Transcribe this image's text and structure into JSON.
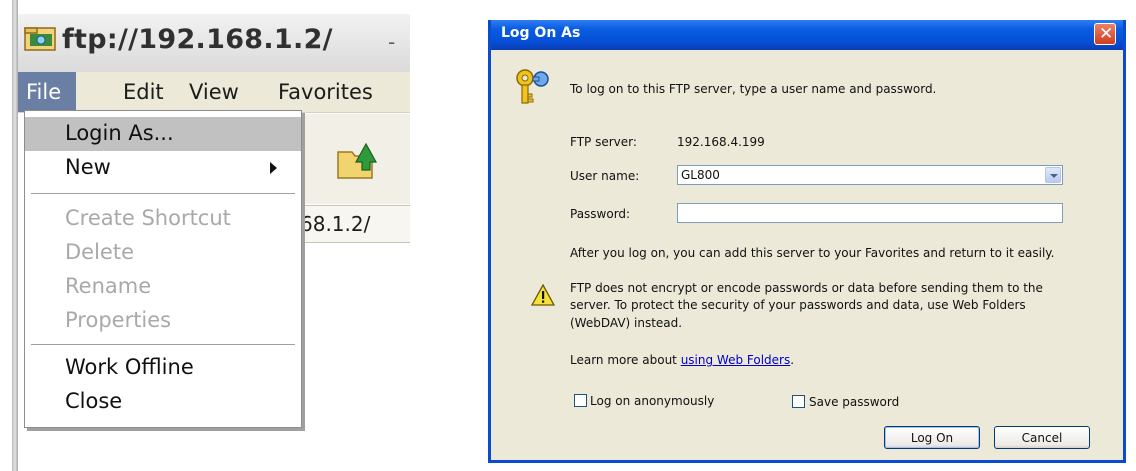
{
  "explorer": {
    "title": "ftp://192.168.1.2/",
    "title_suffix": "-",
    "menubar": [
      "File",
      "Edit",
      "View",
      "Favorites"
    ],
    "address_fragment": "68.1.2/",
    "file_menu": {
      "items": [
        {
          "label": "Login As...",
          "state": "highlighted"
        },
        {
          "label": "New",
          "state": "enabled",
          "submenu": true
        },
        {
          "label": "Create Shortcut",
          "state": "disabled"
        },
        {
          "label": "Delete",
          "state": "disabled"
        },
        {
          "label": "Rename",
          "state": "disabled"
        },
        {
          "label": "Properties",
          "state": "disabled"
        },
        {
          "label": "Work Offline",
          "state": "enabled"
        },
        {
          "label": "Close",
          "state": "enabled"
        }
      ]
    },
    "icons": [
      "ftp-folder-icon",
      "forward-folder-icon",
      "submenu-arrow-icon"
    ]
  },
  "dialog": {
    "title": "Log On As",
    "intro": "To log on to this FTP server, type a user name and password.",
    "ftp_server_label": "FTP server:",
    "ftp_server_value": "192.168.4.199",
    "username_label": "User name:",
    "username_value": "GL800",
    "password_label": "Password:",
    "password_value": "",
    "favorites_note": "After you log on, you can add this server to your Favorites and return to it easily.",
    "warning_line1": "FTP does not encrypt or encode passwords or data before sending them to the",
    "warning_line2": "server.  To protect the security of your passwords and data, use Web Folders",
    "warning_line3": "(WebDAV) instead.",
    "learn_more_prefix": "Learn more about ",
    "learn_more_link": "using Web Folders",
    "learn_more_suffix": ".",
    "anonymous_label": "Log on anonymously",
    "anonymous_checked": false,
    "save_password_label": "Save password",
    "save_password_checked": false,
    "logon_button": "Log On",
    "cancel_button": "Cancel",
    "colors": {
      "titlebar": "#0a5de0",
      "close": "#cf3d1c",
      "face": "#ece9d8",
      "link": "#0000cc"
    },
    "icons": [
      "keys-icon",
      "warning-icon",
      "close-icon",
      "dropdown-arrow-icon"
    ]
  }
}
